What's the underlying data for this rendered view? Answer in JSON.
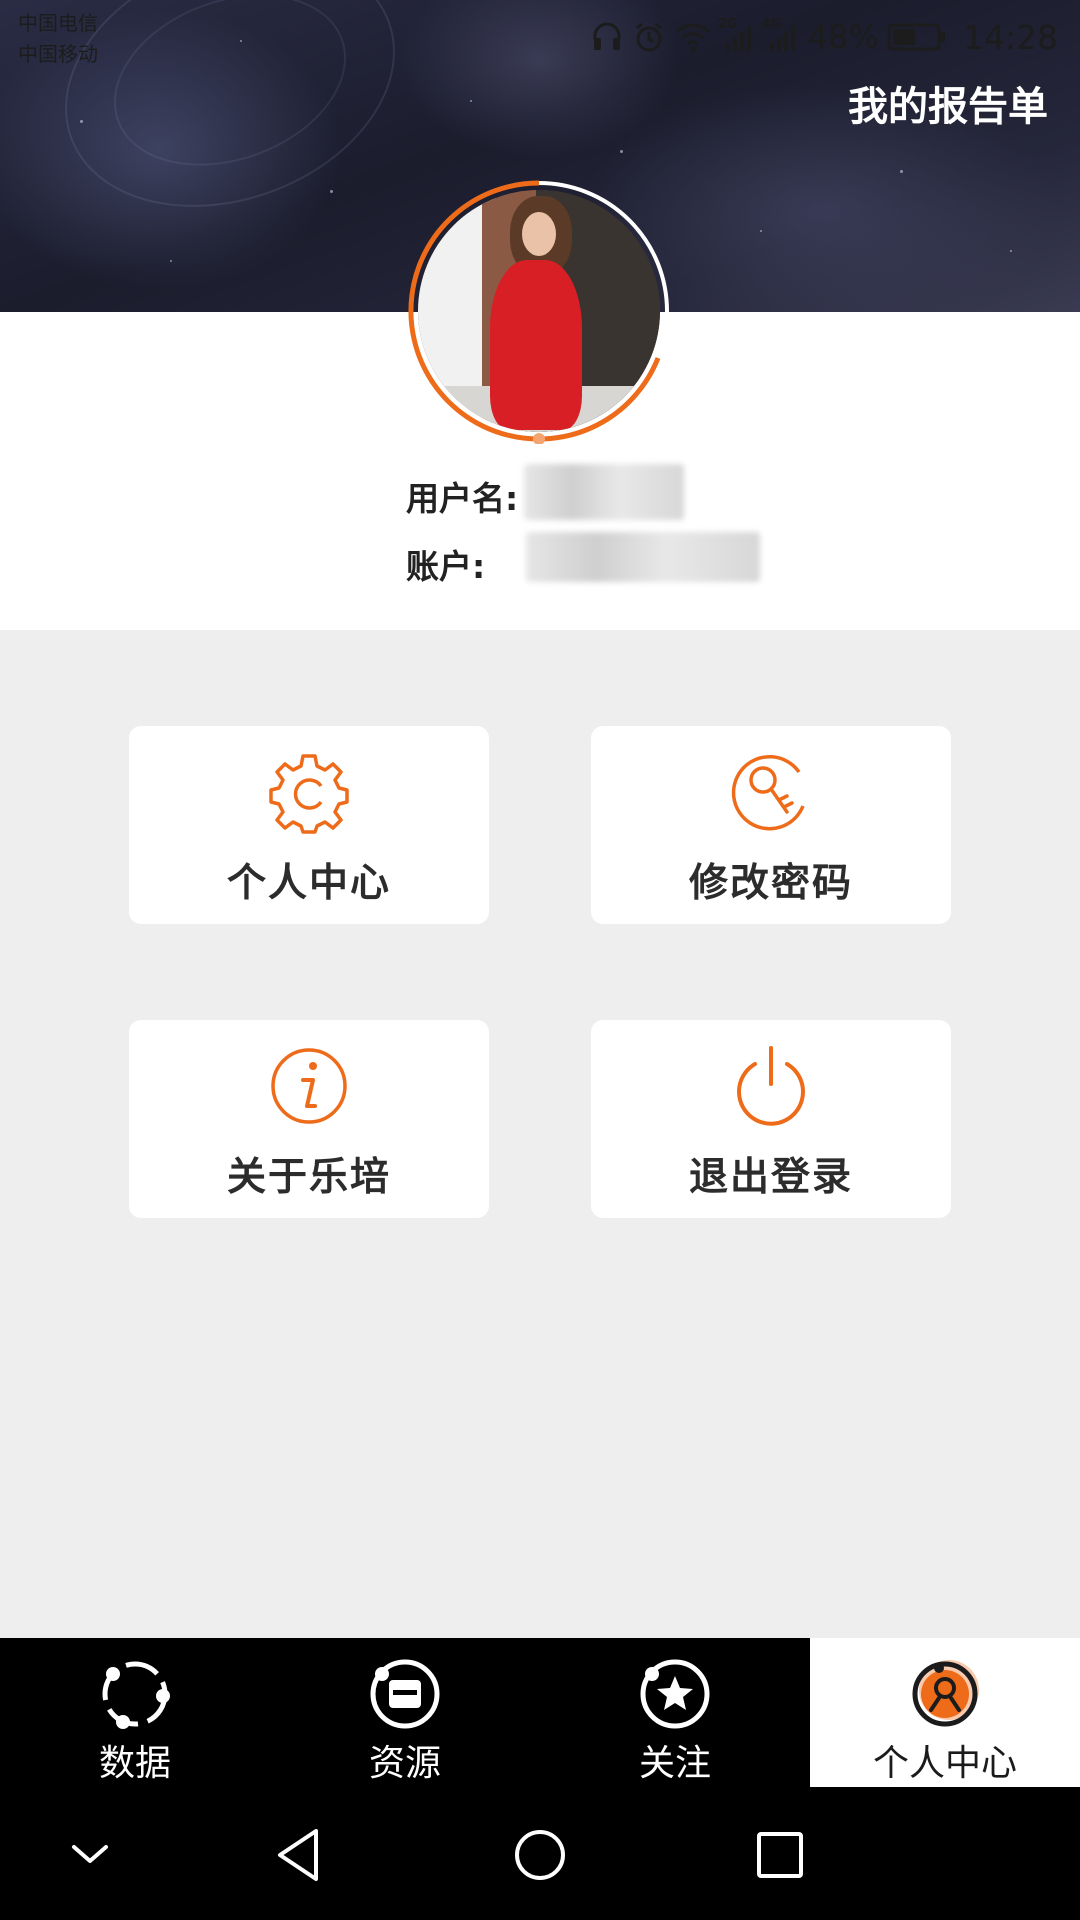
{
  "status_bar": {
    "carrier_1": "中国电信",
    "carrier_2": "中国移动",
    "net_2g": "2G",
    "net_4g": "4G",
    "battery": "48%",
    "time": "14:28",
    "icons": [
      "headphones-icon",
      "alarm-icon",
      "wifi-icon",
      "signal-2g-icon",
      "signal-4g-icon",
      "battery-icon"
    ]
  },
  "header": {
    "report_link": "我的报告单",
    "background": "starry night sky"
  },
  "profile": {
    "username_label": "用户名:",
    "account_label": "账户:",
    "username_value": "",
    "account_value": "",
    "avatar_ring_color": "#ee6b1a"
  },
  "menu": [
    {
      "label": "个人中心",
      "icon": "gear-icon"
    },
    {
      "label": "修改密码",
      "icon": "key-icon"
    },
    {
      "label": "关于乐培",
      "icon": "info-icon"
    },
    {
      "label": "退出登录",
      "icon": "power-icon"
    }
  ],
  "tabs": [
    {
      "label": "数据",
      "icon": "data-circle-icon",
      "active": false
    },
    {
      "label": "资源",
      "icon": "resource-icon",
      "active": false
    },
    {
      "label": "关注",
      "icon": "star-icon",
      "active": false
    },
    {
      "label": "个人中心",
      "icon": "user-icon",
      "active": true
    }
  ],
  "nav_bar": {
    "icons": [
      "chevron-down-icon",
      "back-icon",
      "home-icon",
      "recents-icon"
    ]
  },
  "colors": {
    "accent": "#ee6b1a",
    "page_bg": "#eeeeee",
    "tabbar_bg": "#000000"
  }
}
